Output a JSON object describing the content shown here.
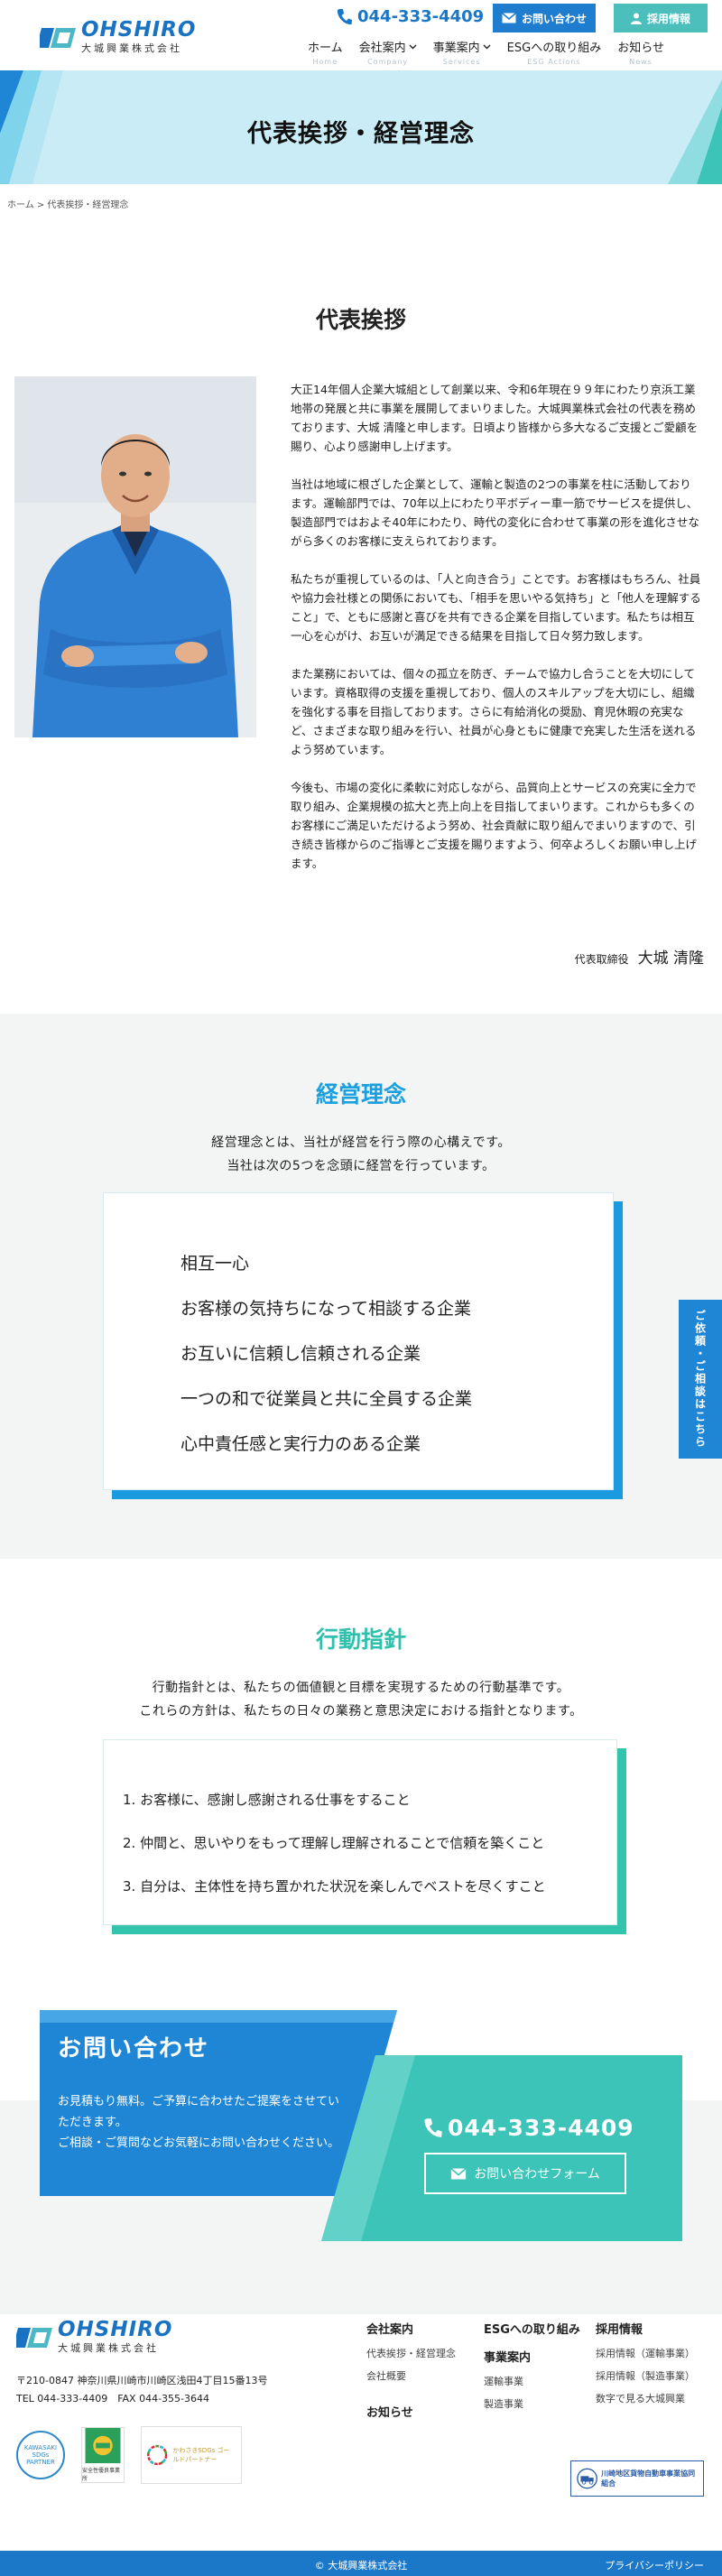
{
  "header": {
    "logo_en": "OHSHIRO",
    "logo_jp": "大城興業株式会社",
    "tel": "044-333-4409",
    "contact_button": "お問い合わせ",
    "recruit_button": "採用情報",
    "nav": [
      {
        "label": "ホーム",
        "sub": "Home"
      },
      {
        "label": "会社案内",
        "sub": "Company"
      },
      {
        "label": "事業案内",
        "sub": "Services"
      },
      {
        "label": "ESGへの取り組み",
        "sub": "ESG Actions"
      },
      {
        "label": "お知らせ",
        "sub": "News"
      }
    ]
  },
  "banner": {
    "title": "代表挨拶・経営理念"
  },
  "breadcrumb": "ホーム > 代表挨拶・経営理念",
  "greeting": {
    "title": "代表挨拶",
    "paragraphs": [
      "大正14年個人企業大城組として創業以来、令和6年現在９９年にわたり京浜工業地帯の発展と共に事業を展開してまいりました。大城興業株式会社の代表を務めております、大城 清隆と申します。日頃より皆様から多大なるご支援とご愛顧を賜り、心より感謝申し上げます。",
      "当社は地域に根ざした企業として、運輸と製造の2つの事業を柱に活動しております。運輸部門では、70年以上にわたり平ボディー車一筋でサービスを提供し、製造部門ではおよそ40年にわたり、時代の変化に合わせて事業の形を進化させながら多くのお客様に支えられております。",
      "私たちが重視しているのは、「人と向き合う」ことです。お客様はもちろん、社員や協力会社様との関係においても、「相手を思いやる気持ち」と「他人を理解すること」で、ともに感謝と喜びを共有できる企業を目指しています。私たちは相互一心を心がけ、お互いが満足できる結果を目指して日々努力致します。",
      "また業務においては、個々の孤立を防ぎ、チームで協力し合うことを大切にしています。資格取得の支援を重視しており、個人のスキルアップを大切にし、組織を強化する事を目指しております。さらに有給消化の奨励、育児休暇の充実など、さまざまな取り組みを行い、社員が心身ともに健康で充実した生活を送れるよう努めています。",
      "今後も、市場の変化に柔軟に対応しながら、品質向上とサービスの充実に全力で取り組み、企業規模の拡大と売上向上を目指してまいります。これからも多くのお客様にご満足いただけるよう努め、社会貢献に取り組んでまいりますので、引き続き皆様からのご指導とご支援を賜りますよう、何卒よろしくお願い申し上げます。"
    ],
    "signature_role": "代表取締役",
    "signature_name": "大城 清隆"
  },
  "philosophy": {
    "title": "経営理念",
    "intro_1": "経営理念とは、当社が経営を行う際の心構えです。",
    "intro_2": "当社は次の5つを念頭に経営を行っています。",
    "items": [
      "相互一心",
      "お客様の気持ちになって相談する企業",
      "お互いに信頼し信頼される企業",
      "一つの和で従業員と共に全員する企業",
      "心中責任感と実行力のある企業"
    ]
  },
  "action": {
    "title": "行動指針",
    "intro_1": "行動指針とは、私たちの価値観と目標を実現するための行動基準です。",
    "intro_2": "これらの方針は、私たちの日々の業務と意思決定における指針となります。",
    "items": [
      "1. お客様に、感謝し感謝される仕事をすること",
      "2. 仲間と、思いやりをもって理解し理解されることで信頼を築くこと",
      "3. 自分は、主体性を持ち置かれた状況を楽しんでベストを尽くすこと"
    ]
  },
  "contact": {
    "title": "お問い合わせ",
    "text_1": "お見積もり無料。ご予算に合わせたご提案をさせていただきます。",
    "text_2": "ご相談・ご質問などお気軽にお問い合わせください。",
    "tel": "044-333-4409",
    "form_button": "お問い合わせフォーム"
  },
  "side_tab": "ご依頼・ご相談はこちら",
  "footer": {
    "logo_en": "OHSHIRO",
    "logo_jp": "大城興業株式会社",
    "address": "〒210-0847 神奈川県川崎市川崎区浅田4丁目15番13号",
    "tel_fax": "TEL 044-333-4409　FAX 044-355-3644",
    "badge_1": "KAWASAKI SDGs PARTNER",
    "badge_2": "安全性優良事業所",
    "badge_3": "かわさきSDGs ゴールドパートナー",
    "col1_head": "会社案内",
    "col1_items": [
      "代表挨拶・経営理念",
      "会社概要"
    ],
    "col1_head2": "お知らせ",
    "col2_head": "ESGへの取り組み",
    "col2_head2": "事業案内",
    "col2_items": [
      "運輸事業",
      "製造事業"
    ],
    "col3_head": "採用情報",
    "col3_items": [
      "採用情報（運輸事業）",
      "採用情報（製造事業）",
      "数字で見る大城興業"
    ],
    "association": "川崎地区貨物自動車事業協同組合",
    "copyright": "© 大城興業株式会社",
    "privacy": "プライバシーポリシー"
  },
  "colors": {
    "primary": "#1f7dcf",
    "teal": "#3cc4b8",
    "cyan_title": "#1aa0df",
    "banner_bg": "#c9ecf6"
  }
}
